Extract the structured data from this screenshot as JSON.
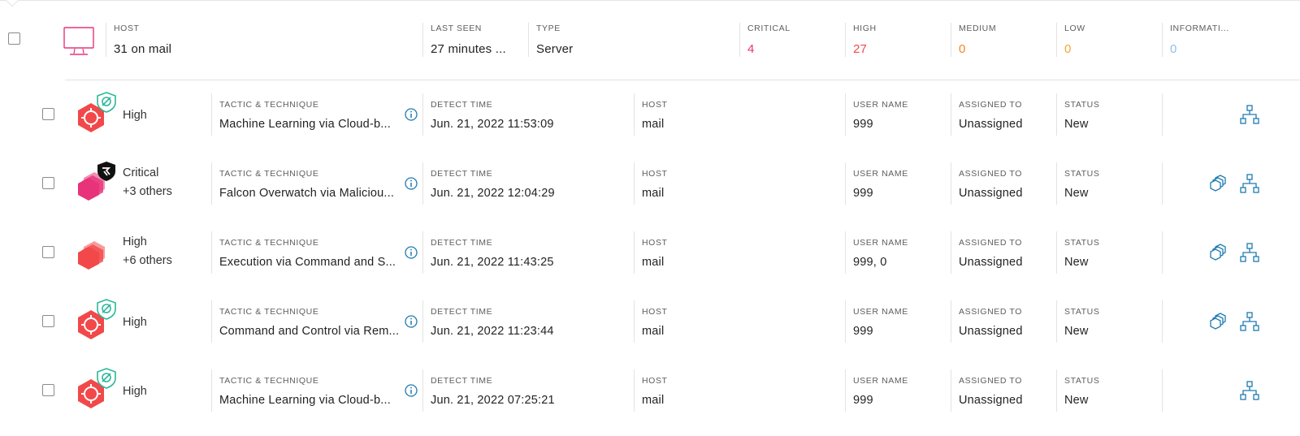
{
  "colors": {
    "critical": "#e8327a",
    "high": "#f2484a",
    "medium": "#f5841f",
    "low": "#f4a731",
    "informational": "#8cc0e8",
    "accent": "#1e7bb0"
  },
  "host": {
    "host_label": "HOST",
    "host_value": "31 on mail",
    "last_seen_label": "LAST SEEN",
    "last_seen_value": "27 minutes ...",
    "type_label": "TYPE",
    "type_value": "Server",
    "critical_label": "CRITICAL",
    "critical_value": "4",
    "high_label": "HIGH",
    "high_value": "27",
    "medium_label": "MEDIUM",
    "medium_value": "0",
    "low_label": "LOW",
    "low_value": "0",
    "info_label": "INFORMATI...",
    "info_value": "0"
  },
  "labels": {
    "tactic": "TACTIC & TECHNIQUE",
    "detect_time": "DETECT TIME",
    "host": "HOST",
    "user_name": "USER NAME",
    "assigned_to": "ASSIGNED TO",
    "status": "STATUS"
  },
  "detections": [
    {
      "severity": "High",
      "others": "",
      "badge": "shield-ml-icon",
      "tactic": "Machine Learning via Cloud-b...",
      "detect_time": "Jun. 21, 2022 11:53:09",
      "host": "mail",
      "user_name": "999",
      "assigned_to": "Unassigned",
      "status": "New",
      "has_related": false
    },
    {
      "severity": "Critical",
      "others": "+3 others",
      "badge": "overwatch-icon",
      "tactic": "Falcon Overwatch via Maliciou...",
      "detect_time": "Jun. 21, 2022 12:04:29",
      "host": "mail",
      "user_name": "999",
      "assigned_to": "Unassigned",
      "status": "New",
      "has_related": true
    },
    {
      "severity": "High",
      "others": "+6 others",
      "badge": "",
      "tactic": "Execution via Command and S...",
      "detect_time": "Jun. 21, 2022 11:43:25",
      "host": "mail",
      "user_name": "999, 0",
      "assigned_to": "Unassigned",
      "status": "New",
      "has_related": true
    },
    {
      "severity": "High",
      "others": "",
      "badge": "shield-ml-icon",
      "tactic": "Command and Control via Rem...",
      "detect_time": "Jun. 21, 2022 11:23:44",
      "host": "mail",
      "user_name": "999",
      "assigned_to": "Unassigned",
      "status": "New",
      "has_related": true
    },
    {
      "severity": "High",
      "others": "",
      "badge": "shield-ml-icon",
      "tactic": "Machine Learning via Cloud-b...",
      "detect_time": "Jun. 21, 2022 07:25:21",
      "host": "mail",
      "user_name": "999",
      "assigned_to": "Unassigned",
      "status": "New",
      "has_related": false
    }
  ]
}
